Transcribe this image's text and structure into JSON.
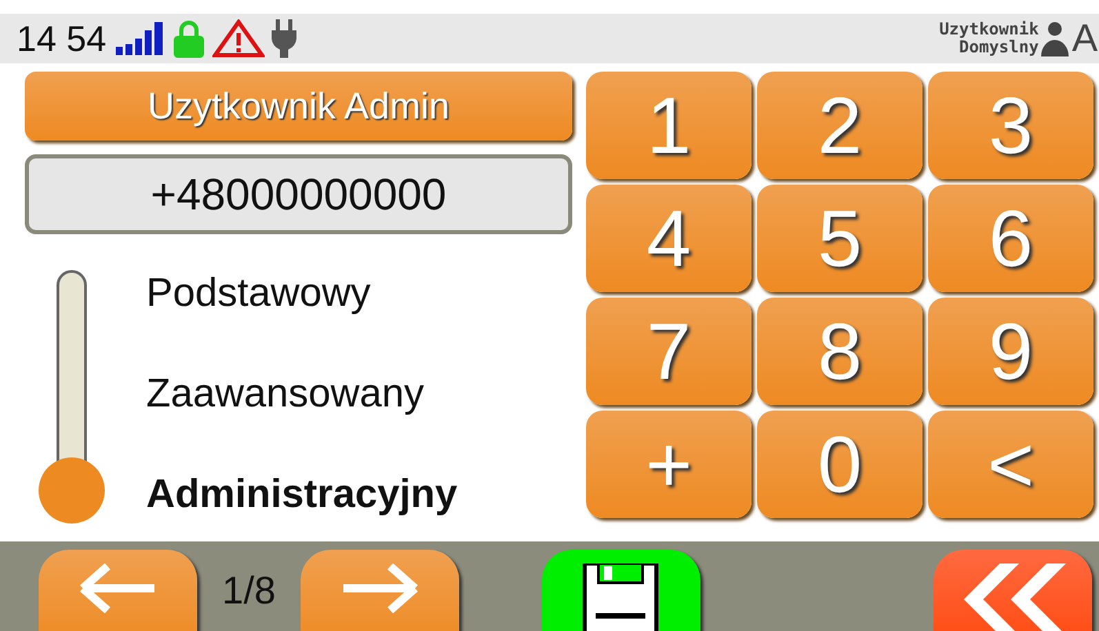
{
  "status_bar": {
    "time": "14 54",
    "user_line_1": "Uzytkownik",
    "user_line_2": "Domyslny",
    "edge_text": "A"
  },
  "user_button": "Uzytkownik Admin",
  "phone_field": {
    "value": "+48000000000"
  },
  "levels": [
    {
      "label": "Podstawowy",
      "selected": false
    },
    {
      "label": "Zaawansowany",
      "selected": false
    },
    {
      "label": "Administracyjny",
      "selected": true
    }
  ],
  "keypad": [
    "1",
    "2",
    "3",
    "4",
    "5",
    "6",
    "7",
    "8",
    "9",
    "+",
    "0",
    "<"
  ],
  "pager": {
    "text": "1/8"
  }
}
